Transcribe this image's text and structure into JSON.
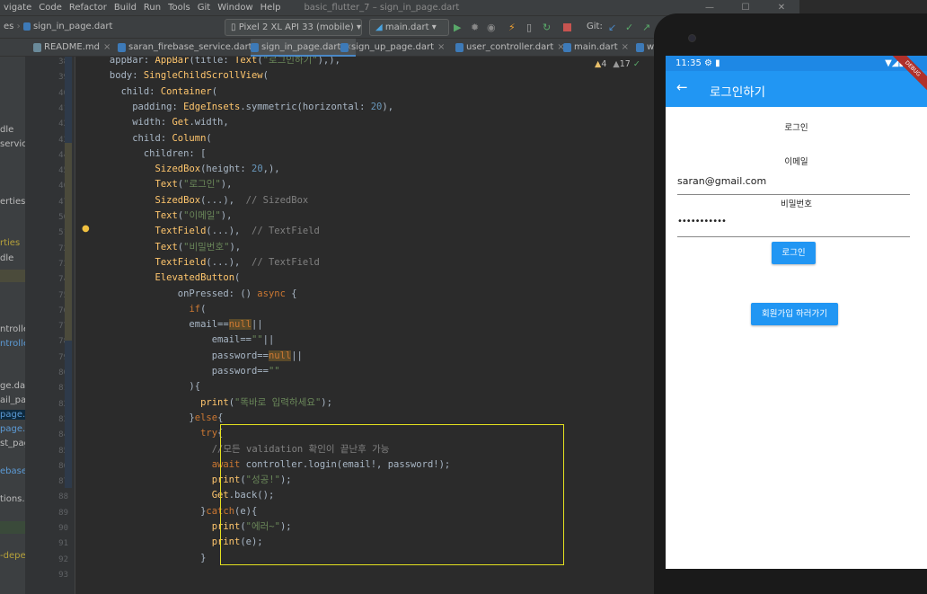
{
  "menu": [
    "vigate",
    "Code",
    "Refactor",
    "Build",
    "Run",
    "Tools",
    "Git",
    "Window",
    "Help"
  ],
  "window_title": "basic_flutter_7 – sign_in_page.dart",
  "window_controls": [
    "—",
    "☐",
    "✕"
  ],
  "toolbar": {
    "breadcrumb_tail": "es",
    "file": "sign_in_page.dart",
    "device": "Pixel 2 XL API 33 (mobile)",
    "run_config": "main.dart",
    "git_label": "Git:"
  },
  "tabs": [
    "README.md",
    "saran_firebase_service.dart",
    "sign_in_page.dart",
    "sign_up_page.dart",
    "user_controller.dart",
    "main.dart",
    "w"
  ],
  "inspections": {
    "warnings": "4",
    "weak_warnings": "17"
  },
  "left_panel": [
    "dle",
    "servic",
    "erties",
    "rties",
    "dle",
    "ntroller",
    "ntroller",
    "ge.dar",
    "ail_pa",
    "page.d",
    "page.d",
    "st_pag",
    "ebase",
    "tions.d",
    "-deper"
  ],
  "line_numbers": [
    "38",
    "39",
    "40",
    "41",
    "42",
    "43",
    "44",
    "45",
    "46",
    "47",
    "50",
    "51",
    "72",
    "73",
    "74",
    "75",
    "76",
    "77",
    "78",
    "79",
    "80",
    "81",
    "82",
    "83",
    "84",
    "85",
    "86",
    "87",
    "88",
    "89",
    "90",
    "91",
    "92",
    "93"
  ],
  "code": [
    "      appBar: AppBar(title: Text(\"로그인하기\"),),",
    "      body: SingleChildScrollView(",
    "        child: Container(",
    "          padding: EdgeInsets.symmetric(horizontal: 20),",
    "          width: Get.width,",
    "          child: Column(",
    "            children: [",
    "              SizedBox(height: 20,),",
    "              Text(\"로그인\"),",
    "              SizedBox(...),  // SizedBox",
    "              Text(\"이메일\"),",
    "              TextField(...),  // TextField",
    "              Text(\"비밀번호\"),",
    "              TextField(...),  // TextField",
    "              ElevatedButton(",
    "                  onPressed: () async {",
    "                    if(",
    "                    email==null||",
    "                        email==\"\"||",
    "                        password==null||",
    "                        password==\"\"",
    "                    ){",
    "                      print(\"똑바로 입력하세요\");",
    "                    }else{",
    "                      try{",
    "                        //모든 validation 확인이 끝난후 가능",
    "                        await controller.login(email!, password!);",
    "                        print(\"성공!\");",
    "                        Get.back();",
    "                      }catch(e){",
    "                        print(\"에러~\");",
    "                        print(e);",
    "                      }",
    ""
  ],
  "phone": {
    "time": "11:35",
    "appbar_title": "로그인하기",
    "back_icon": "arrow-back-icon",
    "debug_banner": "DEBUG",
    "login_label": "로그인",
    "email_label": "이메일",
    "email_value": "saran@gmail.com",
    "password_label": "비밀번호",
    "password_value": "•••••••••••",
    "login_button": "로그인",
    "signup_button": "회원가입 하러가기"
  },
  "colors": {
    "appbar": "#2196f3",
    "highlight_box": "#e3e01f",
    "editor_bg": "#2b2b2b"
  }
}
